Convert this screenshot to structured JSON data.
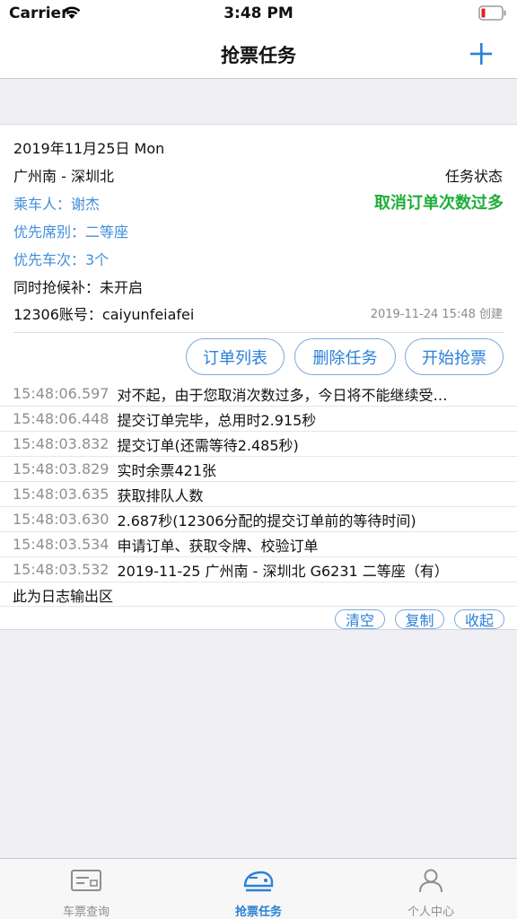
{
  "status_bar": {
    "carrier": "Carrier",
    "time": "3:48 PM"
  },
  "nav": {
    "title": "抢票任务",
    "add_icon": "plus-icon"
  },
  "task": {
    "date": "2019年11月25日 Mon",
    "route": "广州南 - 深圳北",
    "status_label": "任务状态",
    "status_value": "取消订单次数过多",
    "passenger": "乘车人：谢杰",
    "seat_pref": "优先席别：二等座",
    "train_pref": "优先车次：3个",
    "waitlist": "同时抢候补：未开启",
    "account": "12306账号：caiyunfeiafei",
    "created": "2019-11-24 15:48 创建"
  },
  "actions": {
    "order_list": "订单列表",
    "delete_task": "删除任务",
    "start_grab": "开始抢票"
  },
  "log": {
    "entries": [
      {
        "time": "15:48:06.597",
        "message": "对不起，由于您取消次数过多，今日将不能继续受…"
      },
      {
        "time": "15:48:06.448",
        "message": "提交订单完毕，总用时2.915秒"
      },
      {
        "time": "15:48:03.832",
        "message": "提交订单(还需等待2.485秒)"
      },
      {
        "time": "15:48:03.829",
        "message": "实时余票421张"
      },
      {
        "time": "15:48:03.635",
        "message": "获取排队人数"
      },
      {
        "time": "15:48:03.630",
        "message": "2.687秒(12306分配的提交订单前的等待时间)"
      },
      {
        "time": "15:48:03.534",
        "message": "申请订单、获取令牌、校验订单"
      },
      {
        "time": "15:48:03.532",
        "message": "2019-11-25 广州南 - 深圳北 G6231 二等座（有）"
      }
    ],
    "placeholder": "此为日志输出区",
    "clear": "清空",
    "copy": "复制",
    "collapse": "收起"
  },
  "tabs": [
    {
      "label": "车票查询",
      "icon": "ticket-icon",
      "active": false
    },
    {
      "label": "抢票任务",
      "icon": "train-icon",
      "active": true
    },
    {
      "label": "个人中心",
      "icon": "person-icon",
      "active": false
    }
  ],
  "colors": {
    "accent": "#2b80d8",
    "status_green": "#1fae3b",
    "inactive_tab": "#8e8e93"
  }
}
